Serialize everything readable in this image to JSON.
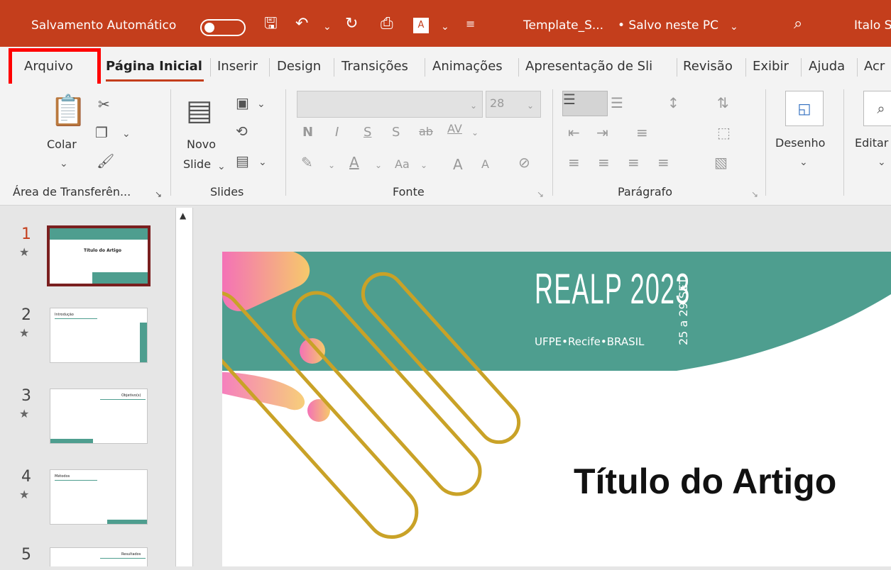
{
  "titlebar": {
    "autosave": "Salvamento Automático",
    "filename": "Template_S...",
    "saved": "• Salvo neste PC",
    "user": "Italo S",
    "icons": [
      "save-icon",
      "undo-icon",
      "redo-icon",
      "present-icon",
      "font-color-icon",
      "customize-icon",
      "search-icon"
    ]
  },
  "tabs": [
    "Arquivo",
    "Página Inicial",
    "Inserir",
    "Design",
    "Transições",
    "Animações",
    "Apresentação de Sli",
    "Revisão",
    "Exibir",
    "Ajuda",
    "Acr"
  ],
  "ribbon": {
    "clipboard": {
      "paste": "Colar",
      "label": "Área de Transferên..."
    },
    "slides": {
      "new_line1": "Novo",
      "new_line2": "Slide",
      "label": "Slides"
    },
    "font": {
      "size": "28",
      "bold": "N",
      "italic": "I",
      "underline": "S",
      "shadow": "S",
      "strike": "ab",
      "spacing": "AV",
      "case": "Aa",
      "grow": "A",
      "shrink": "A",
      "label": "Fonte"
    },
    "paragraph": {
      "label": "Parágrafo"
    },
    "drawing": {
      "label": "Desenho"
    },
    "editing": {
      "label": "Editar"
    }
  },
  "slides": [
    {
      "n": "1",
      "title": "Título do Artigo"
    },
    {
      "n": "2",
      "title": "Introdução"
    },
    {
      "n": "3",
      "title": "Objetivo(s)"
    },
    {
      "n": "4",
      "title": "Métodos"
    },
    {
      "n": "5",
      "title": "Resultados"
    }
  ],
  "main_slide": {
    "brand": "REALP 2023",
    "dates": "25 a 29 SET",
    "place": "UFPE•Recife•BRASIL",
    "title": "Título do Artigo"
  },
  "colors": {
    "accent": "#c43e1c",
    "teal": "#4e9e8f",
    "gold": "#c9a227",
    "pink": "#f472b6"
  }
}
